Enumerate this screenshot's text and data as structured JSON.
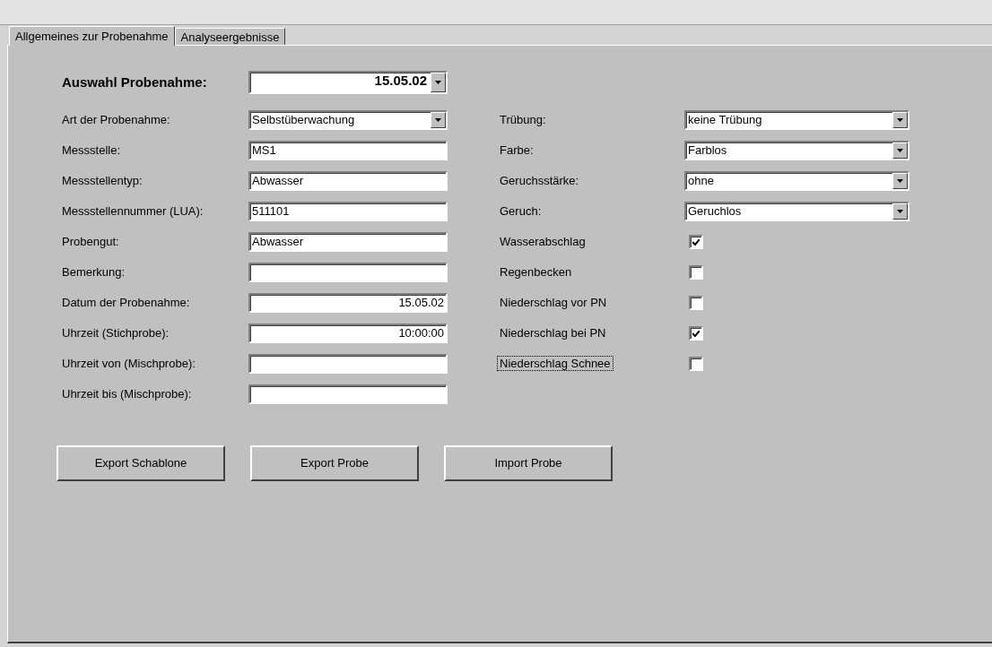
{
  "tabs": [
    {
      "label": "Allgemeines zur Probenahme",
      "selected": true
    },
    {
      "label": "Analyseergebnisse",
      "selected": false
    }
  ],
  "selector": {
    "label": "Auswahl Probenahme:",
    "value": "15.05.02"
  },
  "left_fields": [
    {
      "kind": "combo",
      "label": "Art der Probenahme:",
      "value": "Selbstüberwachung"
    },
    {
      "kind": "text",
      "label": "Messstelle:",
      "value": "MS1",
      "right_aligned": false
    },
    {
      "kind": "text",
      "label": "Messstellentyp:",
      "value": "Abwasser",
      "right_aligned": false
    },
    {
      "kind": "text",
      "label": "Messstellennummer (LUA):",
      "value": "511101",
      "right_aligned": false
    },
    {
      "kind": "text",
      "label": "Probengut:",
      "value": "Abwasser",
      "right_aligned": false
    },
    {
      "kind": "text",
      "label": "Bemerkung:"
    },
    {
      "kind": "text",
      "label": "Datum der Probenahme:",
      "value": "15.05.02",
      "right_aligned": true
    },
    {
      "kind": "text",
      "label": "Uhrzeit (Stichprobe):",
      "value": "10:00:00",
      "right_aligned": true
    },
    {
      "kind": "text",
      "label": "Uhrzeit von (Mischprobe):"
    },
    {
      "kind": "text",
      "label": "Uhrzeit bis (Mischprobe):"
    }
  ],
  "right_fields": [
    {
      "kind": "combo",
      "label": "Trübung:",
      "value": "keine Trübung"
    },
    {
      "kind": "combo",
      "label": "Farbe:",
      "value": "Farblos"
    },
    {
      "kind": "combo",
      "label": "Geruchsstärke:",
      "value": "ohne"
    },
    {
      "kind": "combo",
      "label": "Geruch:",
      "value": "Geruchlos"
    },
    {
      "kind": "checkbox",
      "label": "Wasserabschlag",
      "checked": true,
      "focused": false
    },
    {
      "kind": "checkbox",
      "label": "Regenbecken",
      "checked": false,
      "focused": false
    },
    {
      "kind": "checkbox",
      "label": "Niederschlag vor PN",
      "checked": false,
      "focused": false
    },
    {
      "kind": "checkbox",
      "label": "Niederschlag bei PN",
      "checked": true,
      "focused": false
    },
    {
      "kind": "checkbox",
      "label": "Niederschlag Schnee",
      "checked": false,
      "focused": true
    }
  ],
  "buttons": [
    "Export Schablone",
    "Export Probe",
    "Import Probe"
  ]
}
